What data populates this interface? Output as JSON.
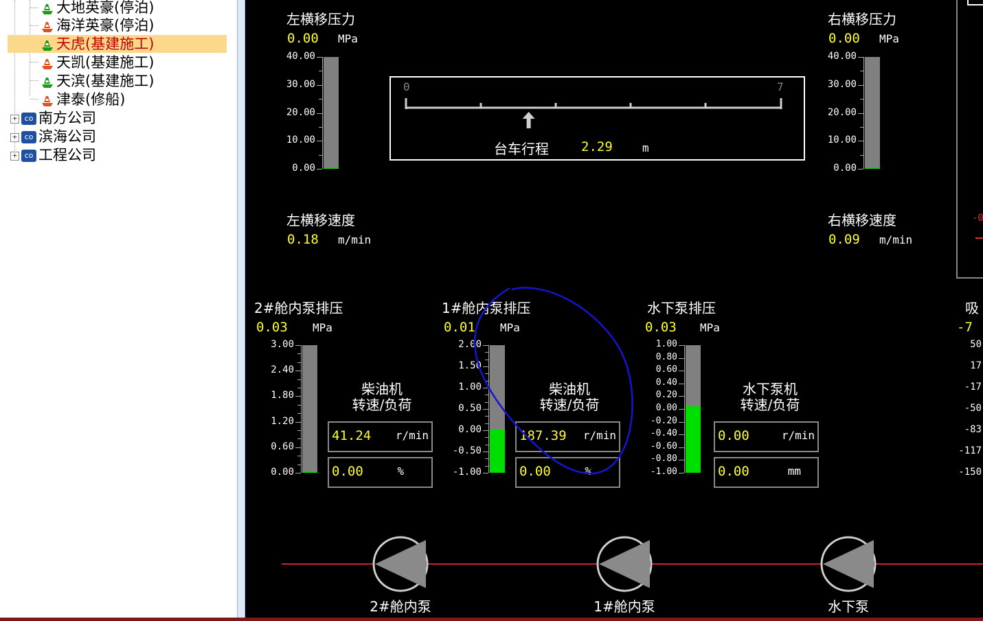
{
  "sidebar": {
    "items": [
      {
        "label": "大地英豪(停泊)",
        "kind": "ship",
        "icon_color": "#1a9a1a"
      },
      {
        "label": "海洋英豪(停泊)",
        "kind": "ship",
        "icon_color": "#e05020"
      },
      {
        "label": "天虎(基建施工)",
        "kind": "ship",
        "icon_color": "#1a9a1a",
        "selected": true
      },
      {
        "label": "天凯(基建施工)",
        "kind": "ship",
        "icon_color": "#e05020"
      },
      {
        "label": "天滨(基建施工)",
        "kind": "ship",
        "icon_color": "#1a9a1a"
      },
      {
        "label": "津泰(修船)",
        "kind": "ship",
        "icon_color": "#e05020"
      },
      {
        "label": "南方公司",
        "kind": "company",
        "icon_text": "co",
        "expander": "+"
      },
      {
        "label": "滨海公司",
        "kind": "company",
        "icon_text": "co",
        "expander": "+"
      },
      {
        "label": "工程公司",
        "kind": "company",
        "icon_text": "co",
        "expander": "+"
      }
    ]
  },
  "scada": {
    "left_press": {
      "label": "左横移压力",
      "value": "0.00",
      "unit": "MPa",
      "level": 0.0,
      "ticks": [
        "40.00",
        "30.00",
        "20.00",
        "10.00",
        "0.00"
      ]
    },
    "right_press": {
      "label": "右横移压力",
      "value": "0.00",
      "unit": "MPa",
      "level": 0.0,
      "ticks": [
        "40.00",
        "30.00",
        "20.00",
        "10.00",
        "0.00"
      ]
    },
    "travel": {
      "label": "台车行程",
      "value": "2.29",
      "unit": "m",
      "min": "0",
      "max": "7",
      "position": 2.29
    },
    "left_speed": {
      "label": "左横移速度",
      "value": "0.18",
      "unit": "m/min"
    },
    "right_speed": {
      "label": "右横移速度",
      "value": "0.09",
      "unit": "m/min"
    },
    "pump2": {
      "label": "2#舱内泵排压",
      "value": "0.03",
      "unit": "MPa",
      "level": 0.01,
      "ticks": [
        "3.00",
        "2.40",
        "1.80",
        "1.20",
        "0.60",
        "0.00"
      ],
      "engine_title_1": "柴油机",
      "engine_title_2": "转速/负荷",
      "speed": "41.24",
      "speed_unit": "r/min",
      "load": "0.00",
      "load_unit": "%",
      "pump_label": "2#舱内泵"
    },
    "pump1": {
      "label": "1#舱内泵排压",
      "value": "0.01",
      "unit": "MPa",
      "level": 0.34,
      "ticks": [
        "2.00",
        "1.50",
        "1.00",
        "0.50",
        "0.00",
        "-0.50",
        "-1.00"
      ],
      "engine_title_1": "柴油机",
      "engine_title_2": "转速/负荷",
      "speed": "187.39",
      "speed_unit": "r/min",
      "load": "0.00",
      "load_unit": "%",
      "pump_label": "1#舱内泵"
    },
    "pump_uw": {
      "label": "水下泵排压",
      "value": "0.03",
      "unit": "MPa",
      "level": 0.52,
      "ticks": [
        "1.00",
        "0.80",
        "0.60",
        "0.40",
        "0.20",
        "0.00",
        "-0.20",
        "-0.40",
        "-0.60",
        "-0.80",
        "-1.00"
      ],
      "engine_title_1": "水下泵机",
      "engine_title_2": "转速/负荷",
      "speed": "0.00",
      "speed_unit": "r/min",
      "load": "0.00",
      "load_unit": "mm",
      "pump_label": "水下泵"
    },
    "suction": {
      "label": "吸",
      "value": "-7",
      "ticks": [
        "50",
        "17",
        "-17",
        "-50",
        "-83",
        "-117",
        "-150"
      ],
      "edge_mark": "-0"
    },
    "colors": {
      "value": "#ffff33",
      "bar": "#808080",
      "fill": "#00dd00",
      "pipe": "#c0282d",
      "annotation": "#1515d0"
    }
  }
}
